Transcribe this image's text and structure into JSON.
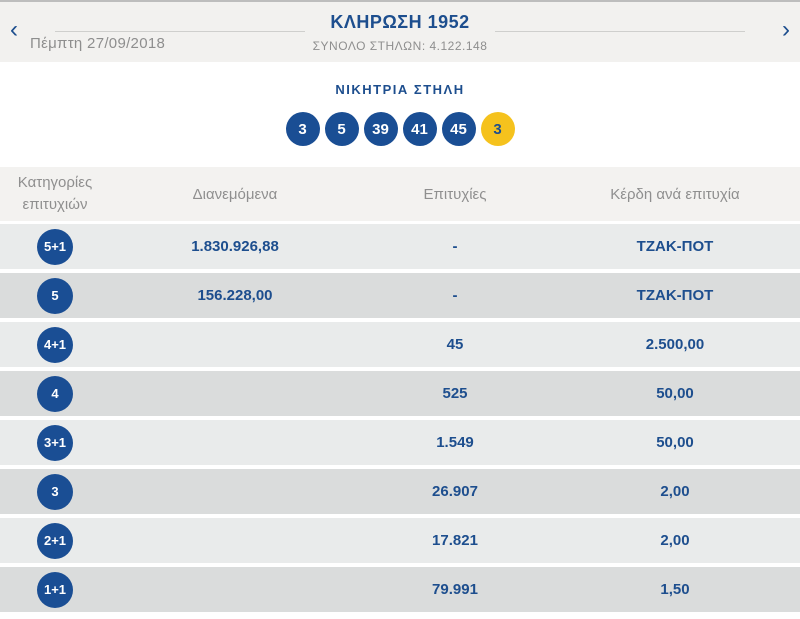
{
  "colors": {
    "accent_blue": "#1d4e8e",
    "ball_blue": "#1a4e94",
    "joker_yellow": "#f5c21d",
    "topbar_bg": "#f2f1ef",
    "row_light": "#e9ebeb",
    "row_dark": "#dadcdc",
    "muted_text": "#8e8e8e"
  },
  "topbar": {
    "prev_arrow": "‹",
    "next_arrow": "›",
    "date": "Πέμπτη 27/09/2018",
    "title": "ΚΛΗΡΩΣΗ 1952",
    "subtitle": "ΣΥΝΟΛΟ ΣΤΗΛΩΝ: 4.122.148"
  },
  "winning_column": {
    "label": "ΝΙΚΗΤΡΙΑ ΣΤΗΛΗ",
    "numbers": [
      "3",
      "5",
      "39",
      "41",
      "45"
    ],
    "joker_number": "3"
  },
  "table": {
    "headers": {
      "category_line1": "Κατηγορίες",
      "category_line2": "επιτυχιών",
      "distributed": "Διανεμόμενα",
      "winners": "Επιτυχίες",
      "prize_per_winner": "Κέρδη ανά επιτυχία"
    },
    "rows": [
      {
        "category": "5+1",
        "distributed": "1.830.926,88",
        "winners": "-",
        "prize": "ΤΖΑΚ-ΠΟΤ"
      },
      {
        "category": "5",
        "distributed": "156.228,00",
        "winners": "-",
        "prize": "ΤΖΑΚ-ΠΟΤ"
      },
      {
        "category": "4+1",
        "distributed": "",
        "winners": "45",
        "prize": "2.500,00"
      },
      {
        "category": "4",
        "distributed": "",
        "winners": "525",
        "prize": "50,00"
      },
      {
        "category": "3+1",
        "distributed": "",
        "winners": "1.549",
        "prize": "50,00"
      },
      {
        "category": "3",
        "distributed": "",
        "winners": "26.907",
        "prize": "2,00"
      },
      {
        "category": "2+1",
        "distributed": "",
        "winners": "17.821",
        "prize": "2,00"
      },
      {
        "category": "1+1",
        "distributed": "",
        "winners": "79.991",
        "prize": "1,50"
      }
    ]
  }
}
